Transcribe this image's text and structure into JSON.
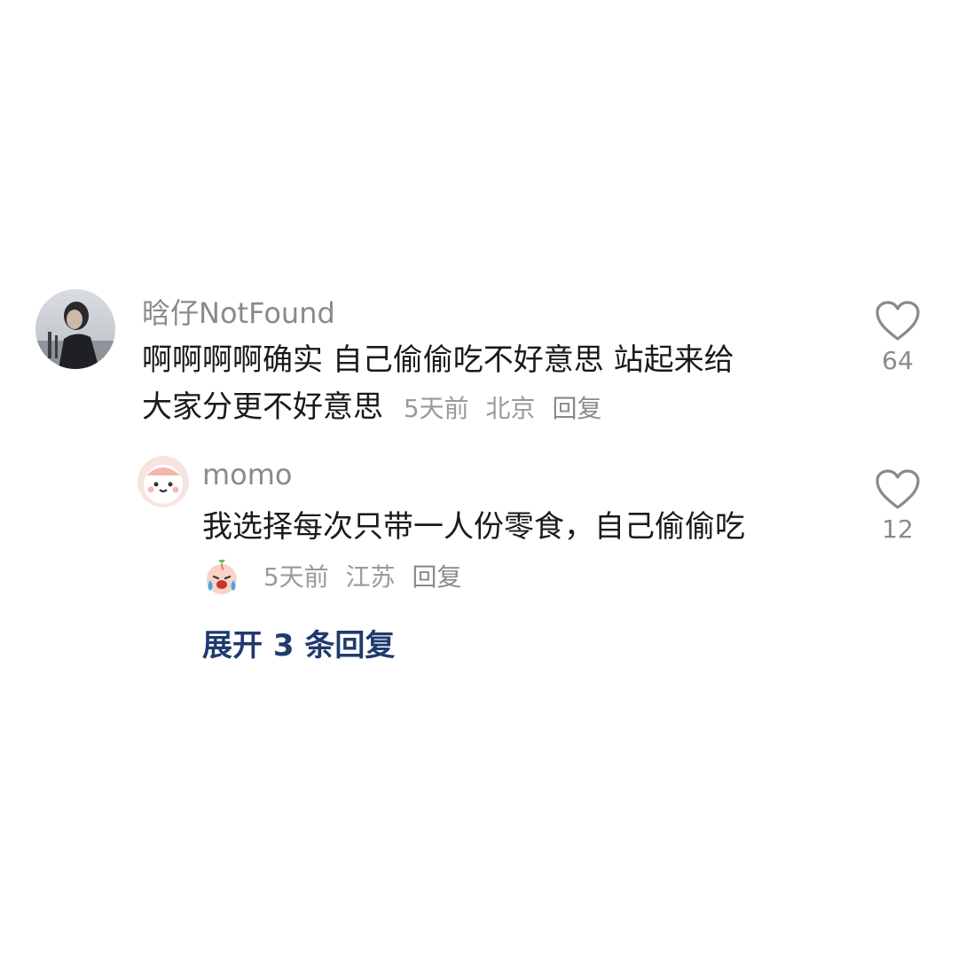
{
  "comments": [
    {
      "username": "晗仔NotFound",
      "text_line1": "啊啊啊啊确实 自己偷偷吃不好意思 站起来给",
      "text_line2": "大家分更不好意思",
      "time": "5天前",
      "location": "北京",
      "reply_label": "回复",
      "likes": "64",
      "avatar_icon": "user-photo-avatar",
      "like_icon": "heart-outline-icon"
    }
  ],
  "replies": [
    {
      "username": "momo",
      "text": "我选择每次只带一人份零食，自己偷偷吃",
      "emoji_icon": "crying-laughing-peach-emoji",
      "time": "5天前",
      "location": "江苏",
      "reply_label": "回复",
      "likes": "12",
      "avatar_icon": "pink-cartoon-avatar",
      "like_icon": "heart-outline-icon"
    }
  ],
  "expand_label": "展开 3 条回复",
  "colors": {
    "text_primary": "#1a1a1a",
    "text_secondary": "#8a8a8a",
    "link": "#1f3a6e",
    "background": "#ffffff"
  }
}
